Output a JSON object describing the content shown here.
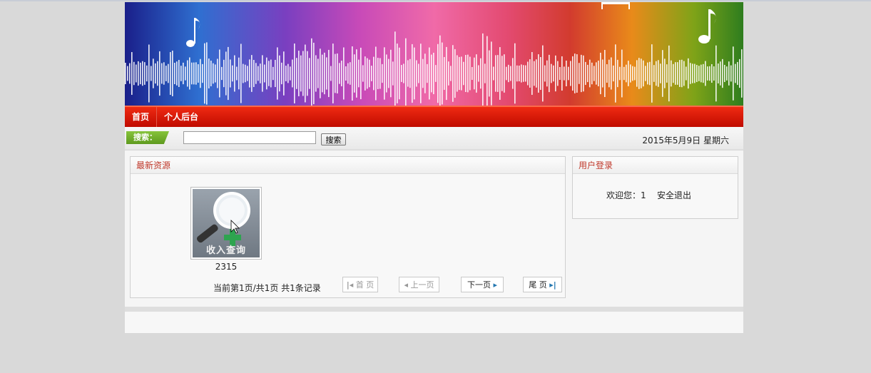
{
  "nav": {
    "items": [
      {
        "label": "首页"
      },
      {
        "label": "个人后台"
      }
    ]
  },
  "search": {
    "tag": "搜索：",
    "value": "",
    "placeholder": "",
    "button": "搜索"
  },
  "date": "2015年5月9日 星期六",
  "resources": {
    "title": "最新资源",
    "items": [
      {
        "thumbnail_text": "收入查询",
        "label": "2315"
      }
    ],
    "pager": {
      "info": "当前第1页/共1页  共1条记录",
      "first": "首 页",
      "prev": "上一页",
      "next": "下一页",
      "last": "尾 页"
    }
  },
  "login": {
    "title": "用户登录",
    "welcome": "欢迎您：1",
    "logout": "安全退出"
  },
  "colors": {
    "nav_red": "#d9140a",
    "accent_green": "#6aa82a",
    "panel_title": "#c0392b"
  }
}
